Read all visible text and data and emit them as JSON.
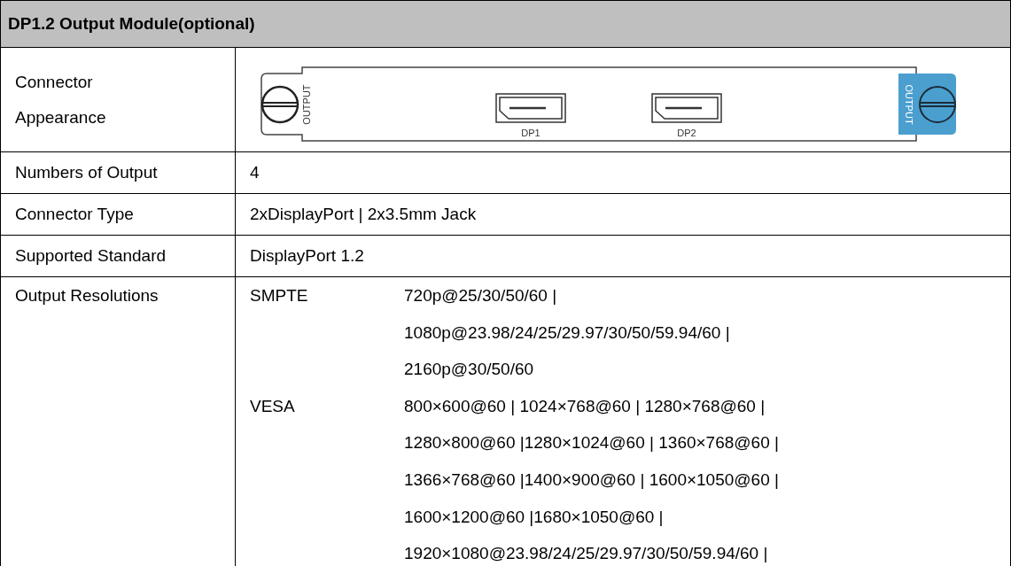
{
  "title": "DP1.2 Output Module(optional)",
  "appearance": {
    "label": "Connector Appearance",
    "module": {
      "left_tab": "OUTPUT",
      "ports": [
        "DP1",
        "DP2"
      ],
      "right_tab": "OUTPUT"
    }
  },
  "specs": [
    {
      "label": "Numbers of Output",
      "value": "4"
    },
    {
      "label": "Connector Type",
      "value": "2xDisplayPort | 2x3.5mm Jack"
    },
    {
      "label": "Supported Standard",
      "value": "DisplayPort 1.2"
    }
  ],
  "resolutions": {
    "label": "Output Resolutions",
    "groups": [
      {
        "standard": "SMPTE",
        "lines": [
          "720p@25/30/50/60 |",
          "1080p@23.98/24/25/29.97/30/50/59.94/60 |",
          "2160p@30/50/60"
        ]
      },
      {
        "standard": "VESA",
        "lines": [
          "800×600@60 | 1024×768@60 | 1280×768@60 |",
          "1280×800@60 |1280×1024@60 | 1360×768@60 |",
          "1366×768@60 |1400×900@60 | 1600×1050@60 |",
          "1600×1200@60 |1680×1050@60 |",
          "1920×1080@23.98/24/25/29.97/30/50/59.94/60 |"
        ]
      }
    ]
  }
}
